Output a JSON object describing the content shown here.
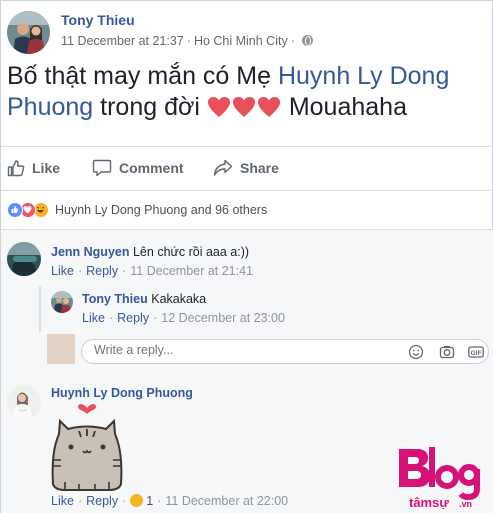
{
  "post": {
    "author": "Tony Thieu",
    "date": "11 December at 21:37",
    "separator": "·",
    "location": "Ho Chi Minh City",
    "text_before": "Bố thật may mắn có Mẹ ",
    "mention": "Huynh Ly Dong Phuong",
    "text_after": " trong đời ",
    "text_end": " Mouahaha"
  },
  "actions": {
    "like": "Like",
    "comment": "Comment",
    "share": "Share"
  },
  "reactions": {
    "summary": "Huynh Ly Dong Phuong and 96 others",
    "types": [
      "like",
      "love",
      "haha"
    ]
  },
  "comments": [
    {
      "name": "Jenn Nguyen",
      "text": "Lên chức rồi aaa a:))",
      "like": "Like",
      "reply": "Reply",
      "time": "11 December at 21:41"
    },
    {
      "name": "Tony Thieu",
      "text": "Kakakaka",
      "like": "Like",
      "reply": "Reply",
      "time": "12 December at 23:00"
    },
    {
      "name": "Huynh Ly Dong Phuong",
      "text": "",
      "like": "Like",
      "reply": "Reply",
      "reaction_count": "1",
      "time": "11 December at 22:00"
    }
  ],
  "reply_box": {
    "placeholder": "Write a reply..."
  },
  "watermark": {
    "line1": "Blog",
    "line2": "tâmsự",
    "suffix": ".vn"
  },
  "colors": {
    "link": "#365899",
    "meta": "#606770",
    "heart": "#e8505b",
    "watermark": "#d6117a"
  }
}
